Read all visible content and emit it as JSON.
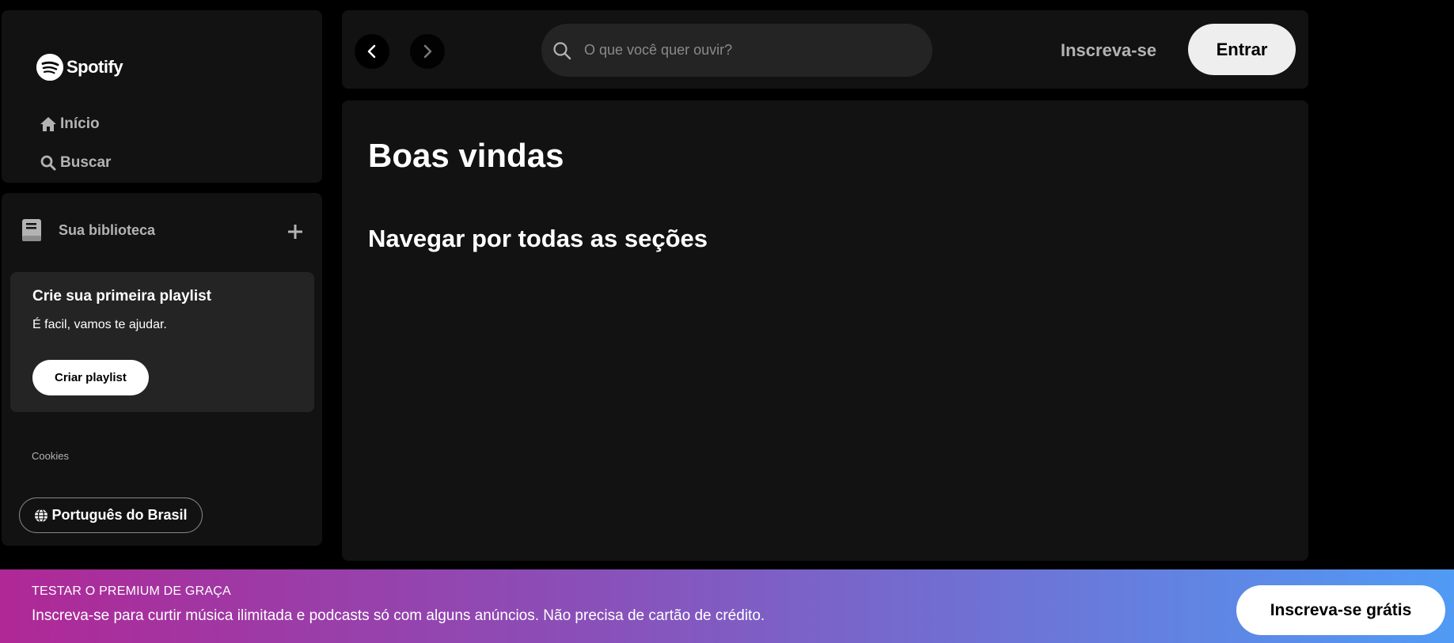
{
  "colors": {
    "background": "#000000",
    "panel": "#121212",
    "card": "#242424",
    "muted_text": "#b3b3b3",
    "banner_gradient_start": "#af2896",
    "banner_gradient_end": "#509bf5"
  },
  "sidebar": {
    "logo": {
      "icon": "spotify-logo-icon",
      "wordmark": "Spotify"
    },
    "nav": [
      {
        "label": "Início",
        "icon": "home-icon"
      },
      {
        "label": "Buscar",
        "icon": "search-icon"
      }
    ]
  },
  "library": {
    "title": "Sua biblioteca",
    "icon": "library-icon",
    "add_icon": "plus-icon",
    "card": {
      "title": "Crie sua primeira playlist",
      "subtitle": "É facil, vamos te ajudar.",
      "button": "Criar playlist"
    },
    "cookies": "Cookies",
    "language_button": {
      "icon": "globe-icon",
      "label": "Português do Brasil"
    }
  },
  "topbar": {
    "back_icon": "chevron-left-icon",
    "forward_icon": "chevron-right-icon",
    "search": {
      "icon": "search-icon",
      "placeholder": "O que você quer ouvir?",
      "value": ""
    },
    "signup": "Inscreva-se",
    "login": "Entrar"
  },
  "main": {
    "title": "Boas vindas",
    "section_title": "Navegar por todas as seções"
  },
  "banner": {
    "kicker": "TESTAR O PREMIUM DE GRAÇA",
    "text": "Inscreva-se para curtir música ilimitada e podcasts só com alguns anúncios. Não precisa de cartão de crédito.",
    "button": "Inscreva-se grátis"
  }
}
